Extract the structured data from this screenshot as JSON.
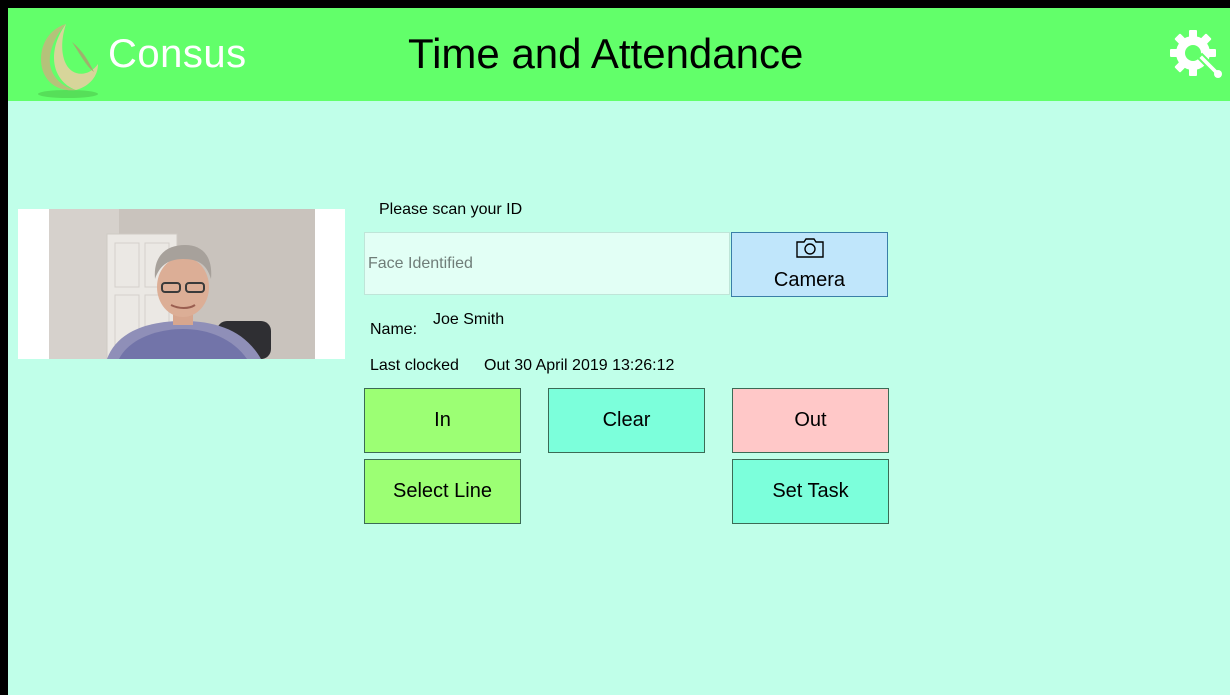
{
  "header": {
    "brand": "Consus",
    "title": "Time and Attendance",
    "settings_icon": "gear-wrench-icon",
    "logo_icon": "crescent-moon-logo"
  },
  "colors": {
    "header_bg": "#62ff6a",
    "page_bg": "#c0ffe9",
    "green_button": "#9cff74",
    "teal_button": "#7cffdb",
    "red_button": "#ffc8c8",
    "camera_button": "#c0e6fb"
  },
  "scan": {
    "prompt": "Please scan your ID",
    "input_value": "Face Identified",
    "camera_label": "Camera",
    "camera_icon": "camera-icon"
  },
  "person": {
    "name_label": "Name:",
    "name_value": "Joe Smith",
    "clock_label": "Last clocked",
    "clock_value": "Out 30 April 2019 13:26:12"
  },
  "buttons": {
    "in": "In",
    "clear": "Clear",
    "out": "Out",
    "select_line": "Select Line",
    "set_task": "Set Task"
  }
}
